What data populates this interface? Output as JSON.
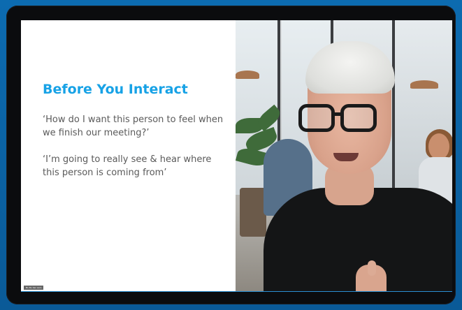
{
  "slide": {
    "title": "Before You Interact",
    "quotes": [
      "‘How do I want this person to feel when we finish our meeting?’",
      "‘I’m going to really see & hear where this person is coming from’"
    ]
  },
  "participant": {
    "name_tag": "Bo Bo Sar Lwin"
  },
  "colors": {
    "frame": "#0c6bb0",
    "bezel": "#0b0c0e",
    "title": "#17a2e6",
    "body_text": "#5a5a5a"
  }
}
